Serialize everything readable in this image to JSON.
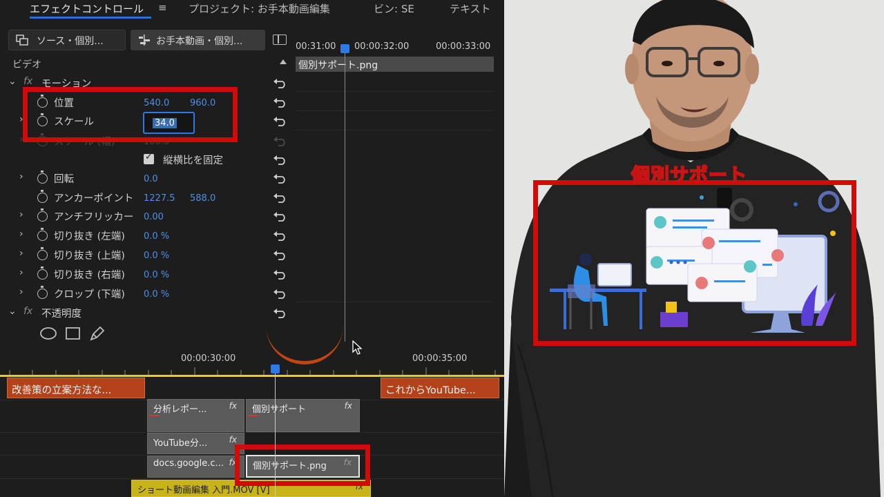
{
  "tabs": {
    "effect_controls": "エフェクトコントロール",
    "menu_icon": "≡",
    "project": "プロジェクト: お手本動画編集",
    "bin": "ビン: SE",
    "text": "テキスト"
  },
  "clip_selector": {
    "source": "ソース・個別...",
    "sequence": "お手本動画・個別..."
  },
  "effects": {
    "section_video": "ビデオ",
    "motion": {
      "name": "モーション",
      "position": {
        "label": "位置",
        "x": "540.0",
        "y": "960.0"
      },
      "scale": {
        "label": "スケール",
        "value": "34.0"
      },
      "scale_width": {
        "label": "スケール (幅)",
        "value": "100.0"
      },
      "uniform_scale": {
        "label": "縦横比を固定",
        "checked": true
      },
      "rotation": {
        "label": "回転",
        "value": "0.0"
      },
      "anchor": {
        "label": "アンカーポイント",
        "x": "1227.5",
        "y": "588.0"
      },
      "antiflicker": {
        "label": "アンチフリッカー",
        "value": "0.00"
      },
      "crop_left": {
        "label": "切り抜き (左端)",
        "value": "0.0 %"
      },
      "crop_top": {
        "label": "切り抜き (上端)",
        "value": "0.0 %"
      },
      "crop_right": {
        "label": "切り抜き (右端)",
        "value": "0.0 %"
      },
      "crop_bottom": {
        "label": "クロップ (下端)",
        "value": "0.0 %"
      }
    },
    "opacity": {
      "name": "不透明度"
    },
    "fx_mark": "fx"
  },
  "effect_timeline": {
    "times": [
      "00:31:00",
      "00:00:32:00",
      "00:00:33:00"
    ],
    "clip_name": "個別サポート.png"
  },
  "timeline": {
    "times": [
      "00:00:30:00",
      "00:00:35:00"
    ],
    "captions": [
      "改善策の立案方法な...",
      "これからYouTube..."
    ],
    "clips": {
      "v3_a": "分析レポー...",
      "v3_b": "個別サポート",
      "v2": "YouTube分...",
      "v1_a": "docs.google.c...",
      "v1_selected": "個別サポート.png",
      "audio": "ショート動画編集 入門.MOV [V]"
    },
    "fx": "fx"
  },
  "preview": {
    "overlay_title": "個別サポート"
  },
  "colors": {
    "highlight_red": "#d10a0a",
    "accent_blue": "#2f7ae5",
    "value_blue": "#4f8fe6",
    "caption_orange": "#b3421b",
    "timeline_yellow": "#e3d21a"
  }
}
